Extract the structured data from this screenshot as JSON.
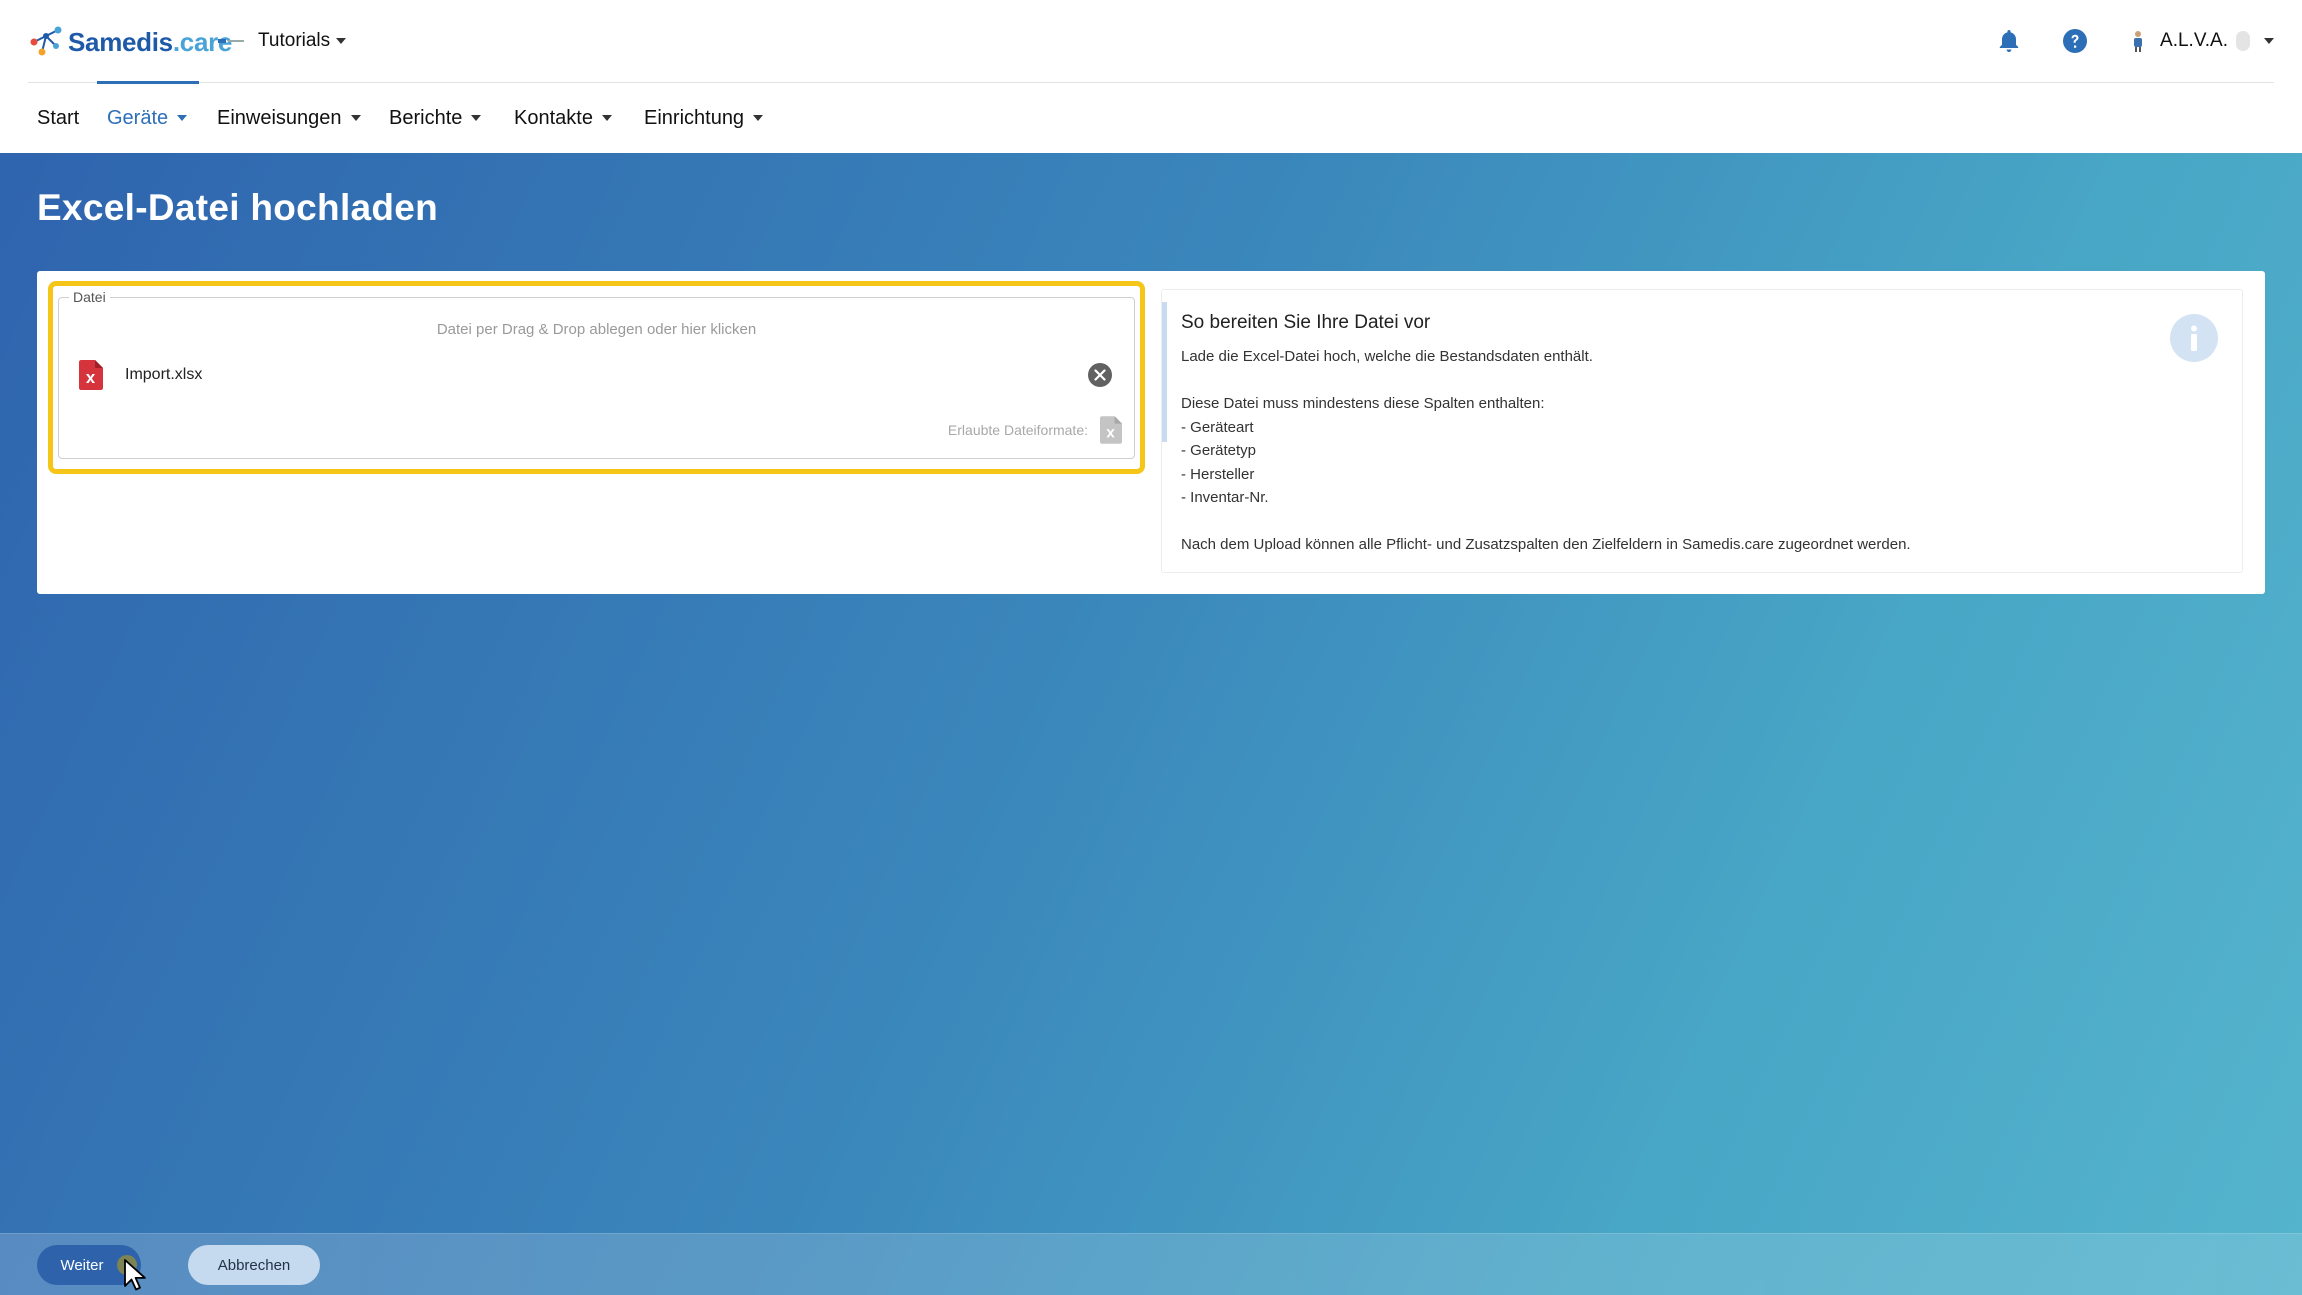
{
  "app": {
    "brand_part1": "Samedis",
    "brand_part2": ".care",
    "tenant_name": "Tutorials",
    "user_name": "A.L.V.A."
  },
  "nav": {
    "items": [
      {
        "label": "Start"
      },
      {
        "label": "Geräte"
      },
      {
        "label": "Einweisungen"
      },
      {
        "label": "Berichte"
      },
      {
        "label": "Kontakte"
      },
      {
        "label": "Einrichtung"
      }
    ],
    "active": "Geräte"
  },
  "page": {
    "title": "Excel-Datei hochladen"
  },
  "upload": {
    "legend": "Datei",
    "dropzone_hint": "Datei per Drag & Drop ablegen oder hier klicken",
    "file_name": "Import.xlsx",
    "allowed_formats_label": "Erlaubte Dateiformate:"
  },
  "info": {
    "title": "So bereiten Sie Ihre Datei vor",
    "lines": [
      "Lade die Excel-Datei hoch, welche die Bestandsdaten enthält.",
      "",
      "Diese Datei muss mindestens diese Spalten enthalten:",
      "- Geräteart",
      "- Gerätetyp",
      "- Hersteller",
      "- Inventar-Nr.",
      "",
      "Nach dem Upload können alle Pflicht- und Zusatzspalten den Zielfeldern in Samedis.care zugeordnet werden."
    ]
  },
  "footer": {
    "next_label": "Weiter",
    "cancel_label": "Abbrechen"
  },
  "colors": {
    "primary": "#2d6fb7",
    "highlight": "#f5c518",
    "excel_red": "#d6343c"
  },
  "icons": [
    "bell-icon",
    "help-icon",
    "excel-file-icon",
    "close-circle-icon",
    "info-icon"
  ]
}
